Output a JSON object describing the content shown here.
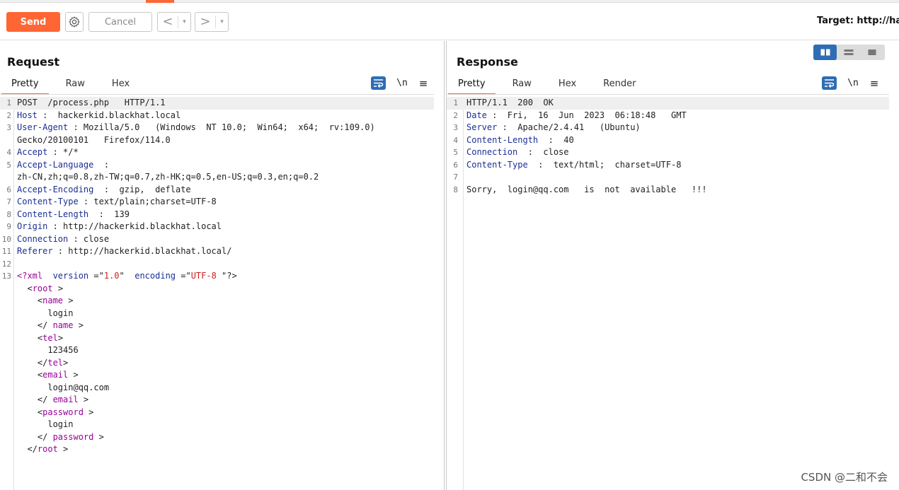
{
  "toolbar": {
    "send_label": "Send",
    "cancel_label": "Cancel",
    "back_symbol": "<",
    "forward_symbol": ">",
    "dropdown_symbol": "▾",
    "target_label": "Target: http://ha"
  },
  "request": {
    "title": "Request",
    "tabs": [
      "Pretty",
      "Raw",
      "Hex"
    ],
    "active_tab": "Pretty",
    "newline_symbol": "\\n",
    "menu_symbol": "≡",
    "lines": [
      {
        "n": "1",
        "segments": [
          {
            "c": "plain",
            "text": "POST  /process.php   HTTP/1.1"
          }
        ]
      },
      {
        "n": "2",
        "segments": [
          {
            "c": "k",
            "text": "Host"
          },
          {
            "c": "plain",
            "text": " :  hackerkid.blackhat.local"
          }
        ]
      },
      {
        "n": "3",
        "segments": [
          {
            "c": "k",
            "text": "User-Agent"
          },
          {
            "c": "plain",
            "text": " : Mozilla/5.0   (Windows  NT 10.0;  Win64;  x64;  rv:109.0)"
          }
        ]
      },
      {
        "n": "",
        "segments": [
          {
            "c": "plain",
            "text": "Gecko/20100101   Firefox/114.0"
          }
        ]
      },
      {
        "n": "4",
        "segments": [
          {
            "c": "k",
            "text": "Accept"
          },
          {
            "c": "plain",
            "text": " : */*"
          }
        ]
      },
      {
        "n": "5",
        "segments": [
          {
            "c": "k",
            "text": "Accept-Language"
          },
          {
            "c": "plain",
            "text": "  :"
          }
        ]
      },
      {
        "n": "",
        "segments": [
          {
            "c": "plain",
            "text": "zh-CN,zh;q=0.8,zh-TW;q=0.7,zh-HK;q=0.5,en-US;q=0.3,en;q=0.2"
          }
        ]
      },
      {
        "n": "6",
        "segments": [
          {
            "c": "k",
            "text": "Accept-Encoding"
          },
          {
            "c": "plain",
            "text": "  :  gzip,  deflate"
          }
        ]
      },
      {
        "n": "7",
        "segments": [
          {
            "c": "k",
            "text": "Content-Type"
          },
          {
            "c": "plain",
            "text": " : text/plain;charset=UTF-8"
          }
        ]
      },
      {
        "n": "8",
        "segments": [
          {
            "c": "k",
            "text": "Content-Length"
          },
          {
            "c": "plain",
            "text": "  :  139"
          }
        ]
      },
      {
        "n": "9",
        "segments": [
          {
            "c": "k",
            "text": "Origin"
          },
          {
            "c": "plain",
            "text": " : http://hackerkid.blackhat.local"
          }
        ]
      },
      {
        "n": "10",
        "segments": [
          {
            "c": "k",
            "text": "Connection"
          },
          {
            "c": "plain",
            "text": " : close"
          }
        ]
      },
      {
        "n": "11",
        "segments": [
          {
            "c": "k",
            "text": "Referer"
          },
          {
            "c": "plain",
            "text": " : http://hackerkid.blackhat.local/"
          }
        ]
      },
      {
        "n": "12",
        "segments": []
      },
      {
        "n": "13",
        "segments": [
          {
            "c": "t",
            "text": "<?xml"
          },
          {
            "c": "plain",
            "text": "  "
          },
          {
            "c": "s",
            "text": "version"
          },
          {
            "c": "plain",
            "text": " ="
          },
          {
            "c": "plain",
            "text": "\""
          },
          {
            "c": "sv",
            "text": "1.0"
          },
          {
            "c": "plain",
            "text": "\"  "
          },
          {
            "c": "s",
            "text": "encoding"
          },
          {
            "c": "plain",
            "text": " ="
          },
          {
            "c": "plain",
            "text": "\""
          },
          {
            "c": "sv",
            "text": "UTF-8"
          },
          {
            "c": "plain",
            "text": " \"?>"
          }
        ]
      },
      {
        "n": "",
        "segments": [
          {
            "c": "plain",
            "text": "  <"
          },
          {
            "c": "t",
            "text": "root"
          },
          {
            "c": "plain",
            "text": " >"
          }
        ]
      },
      {
        "n": "",
        "segments": [
          {
            "c": "plain",
            "text": "    <"
          },
          {
            "c": "t",
            "text": "name"
          },
          {
            "c": "plain",
            "text": " >"
          }
        ]
      },
      {
        "n": "",
        "segments": [
          {
            "c": "plain",
            "text": "      login"
          }
        ]
      },
      {
        "n": "",
        "segments": [
          {
            "c": "plain",
            "text": "    </ "
          },
          {
            "c": "t",
            "text": "name"
          },
          {
            "c": "plain",
            "text": " >"
          }
        ]
      },
      {
        "n": "",
        "segments": [
          {
            "c": "plain",
            "text": "    <"
          },
          {
            "c": "t",
            "text": "tel"
          },
          {
            "c": "plain",
            "text": ">"
          }
        ]
      },
      {
        "n": "",
        "segments": [
          {
            "c": "plain",
            "text": "      123456"
          }
        ]
      },
      {
        "n": "",
        "segments": [
          {
            "c": "plain",
            "text": "    </"
          },
          {
            "c": "t",
            "text": "tel"
          },
          {
            "c": "plain",
            "text": ">"
          }
        ]
      },
      {
        "n": "",
        "segments": [
          {
            "c": "plain",
            "text": "    <"
          },
          {
            "c": "t",
            "text": "email"
          },
          {
            "c": "plain",
            "text": " >"
          }
        ]
      },
      {
        "n": "",
        "segments": [
          {
            "c": "plain",
            "text": "      login@qq.com"
          }
        ]
      },
      {
        "n": "",
        "segments": [
          {
            "c": "plain",
            "text": "    </ "
          },
          {
            "c": "t",
            "text": "email"
          },
          {
            "c": "plain",
            "text": " >"
          }
        ]
      },
      {
        "n": "",
        "segments": [
          {
            "c": "plain",
            "text": "    <"
          },
          {
            "c": "t",
            "text": "password"
          },
          {
            "c": "plain",
            "text": " >"
          }
        ]
      },
      {
        "n": "",
        "segments": [
          {
            "c": "plain",
            "text": "      login"
          }
        ]
      },
      {
        "n": "",
        "segments": [
          {
            "c": "plain",
            "text": "    </ "
          },
          {
            "c": "t",
            "text": "password"
          },
          {
            "c": "plain",
            "text": " >"
          }
        ]
      },
      {
        "n": "",
        "segments": [
          {
            "c": "plain",
            "text": "  </"
          },
          {
            "c": "t",
            "text": "root"
          },
          {
            "c": "plain",
            "text": " >"
          }
        ]
      }
    ]
  },
  "response": {
    "title": "Response",
    "tabs": [
      "Pretty",
      "Raw",
      "Hex",
      "Render"
    ],
    "active_tab": "Pretty",
    "newline_symbol": "\\n",
    "menu_symbol": "≡",
    "lines": [
      {
        "n": "1",
        "segments": [
          {
            "c": "plain",
            "text": "HTTP/1.1  200  OK"
          }
        ]
      },
      {
        "n": "2",
        "segments": [
          {
            "c": "k",
            "text": "Date"
          },
          {
            "c": "plain",
            "text": " :  Fri,  16  Jun  2023  06:18:48   GMT"
          }
        ]
      },
      {
        "n": "3",
        "segments": [
          {
            "c": "k",
            "text": "Server"
          },
          {
            "c": "plain",
            "text": " :  Apache/2.4.41   (Ubuntu)"
          }
        ]
      },
      {
        "n": "4",
        "segments": [
          {
            "c": "k",
            "text": "Content-Length"
          },
          {
            "c": "plain",
            "text": "  :  40"
          }
        ]
      },
      {
        "n": "5",
        "segments": [
          {
            "c": "k",
            "text": "Connection"
          },
          {
            "c": "plain",
            "text": "  :  close"
          }
        ]
      },
      {
        "n": "6",
        "segments": [
          {
            "c": "k",
            "text": "Content-Type"
          },
          {
            "c": "plain",
            "text": "  :  text/html;  charset=UTF-8"
          }
        ]
      },
      {
        "n": "7",
        "segments": []
      },
      {
        "n": "8",
        "segments": [
          {
            "c": "plain",
            "text": "Sorry,  login@qq.com   is  not  available   !!!"
          }
        ]
      }
    ]
  },
  "watermark": "CSDN @二和不会",
  "colors": {
    "accent": "#ff6633",
    "header_key": "#1c2e94",
    "xml_tag": "#990099",
    "xml_value": "#cc2222",
    "toggle_blue": "#2e6db4"
  },
  "icons": [
    "gear-icon",
    "word-wrap-icon",
    "newline-icon",
    "menu-icon",
    "layout-split-icon",
    "layout-stack-icon",
    "layout-single-icon"
  ]
}
